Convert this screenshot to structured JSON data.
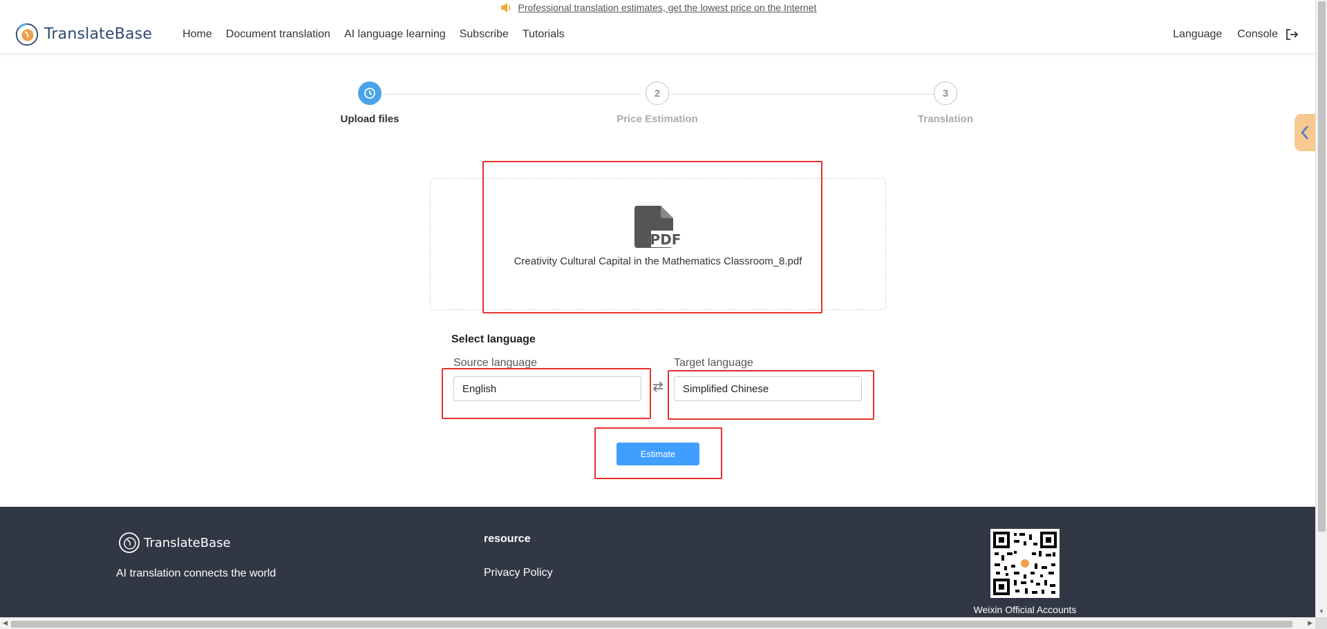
{
  "announcement": {
    "text": "Professional translation estimates, get the lowest price on the Internet",
    "icon": "speaker-icon"
  },
  "header": {
    "brand": "TranslateBase",
    "nav": [
      "Home",
      "Document translation",
      "AI language learning",
      "Subscribe",
      "Tutorials"
    ],
    "language_label": "Language",
    "console_label": "Console"
  },
  "steps": [
    {
      "number": "1",
      "label": "Upload files",
      "state": "active"
    },
    {
      "number": "2",
      "label": "Price Estimation",
      "state": "inactive"
    },
    {
      "number": "3",
      "label": "Translation",
      "state": "inactive"
    }
  ],
  "upload": {
    "file_name": "Creativity Cultural Capital in the Mathematics Classroom_8.pdf",
    "file_type_icon": "pdf-file-icon"
  },
  "language": {
    "title": "Select language",
    "source_label": "Source language",
    "source_value": "English",
    "target_label": "Target language",
    "target_value": "Simplified Chinese"
  },
  "estimate_label": "Estimate",
  "footer": {
    "brand": "TranslateBase",
    "tagline": "AI translation connects the world",
    "resource_title": "resource",
    "privacy_policy": "Privacy Policy",
    "qr_label": "Weixin Official Accounts"
  },
  "colors": {
    "accent": "#409eff",
    "step_active": "#4aa3e8",
    "annotation_red": "#e5322d",
    "footer_bg": "#313744",
    "side_tab": "#f7c88f"
  }
}
